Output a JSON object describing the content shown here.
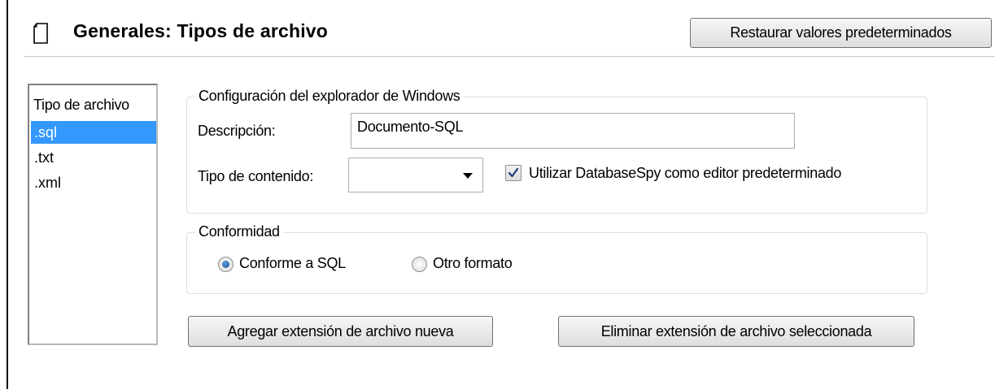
{
  "header": {
    "title": "Generales: Tipos de archivo",
    "restore_button": "Restaurar valores predeterminados",
    "icon": "document-icon"
  },
  "file_types": {
    "header": "Tipo de archivo",
    "items": [
      ".sql",
      ".txt",
      ".xml"
    ],
    "selected": ".sql"
  },
  "windows_explorer": {
    "legend": "Configuración del explorador de Windows",
    "description_label": "Descripción:",
    "description_value": "Documento-SQL",
    "content_type_label": "Tipo de contenido:",
    "content_type_value": "",
    "default_editor_label": "Utilizar DatabaseSpy como editor predeterminado",
    "default_editor_checked": true
  },
  "conformity": {
    "legend": "Conformidad",
    "options": [
      "Conforme a SQL",
      "Otro formato"
    ],
    "selected": "Conforme a SQL"
  },
  "actions": {
    "add_label": "Agregar extensión de archivo nueva",
    "delete_label": "Eliminar extensión de archivo seleccionada"
  },
  "colors": {
    "selection": "#3399ff",
    "group_border": "#d5dfe5"
  }
}
